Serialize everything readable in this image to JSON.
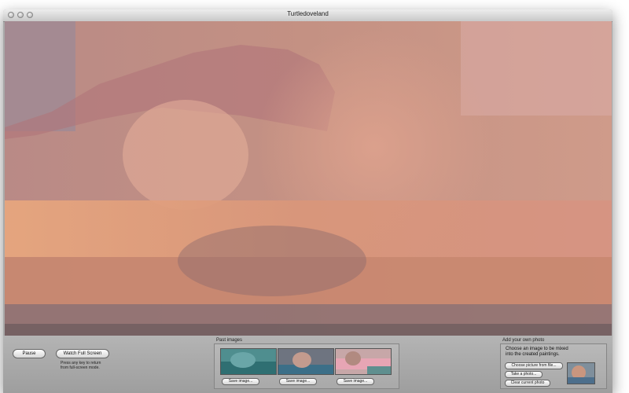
{
  "window": {
    "title": "Turtledoveland"
  },
  "controls": {
    "pause_label": "Pause",
    "fullscreen_label": "Watch Full Screen",
    "hint_line1": "Press any key to return",
    "hint_line2": "from full-screen mode."
  },
  "past_images": {
    "label": "Past images",
    "items": [
      {
        "save_label": "Save image..."
      },
      {
        "save_label": "Save image..."
      },
      {
        "save_label": "Save image..."
      }
    ]
  },
  "add_photo": {
    "label": "Add your own photo",
    "text_line1": "Choose an image to be mixed",
    "text_line2": "into the created paintings.",
    "choose_label": "Choose picture from file...",
    "take_label": "Take a photo...",
    "clear_label": "Clear current photo"
  }
}
